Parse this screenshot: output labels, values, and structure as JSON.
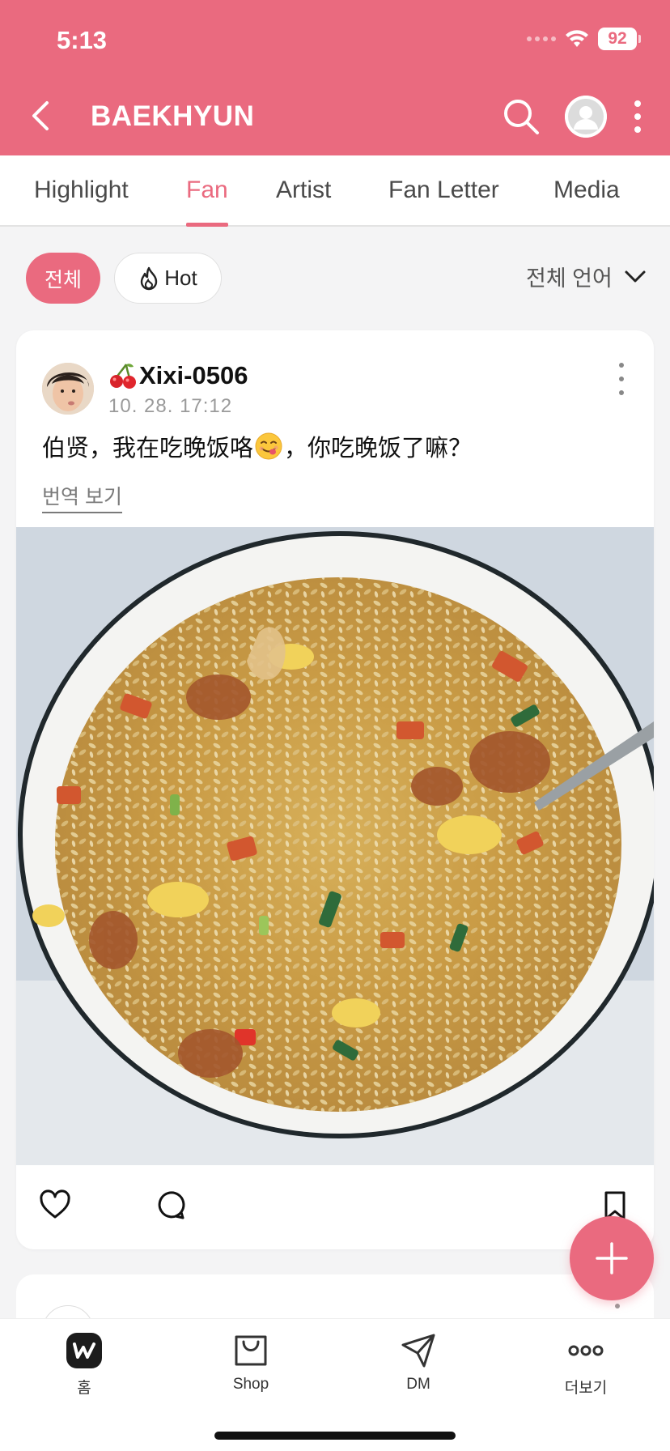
{
  "status_bar": {
    "time": "5:13",
    "battery": "92"
  },
  "header": {
    "title": "BAEKHYUN"
  },
  "tabs": [
    {
      "label": "Highlight",
      "active": false
    },
    {
      "label": "Fan",
      "active": true
    },
    {
      "label": "Artist",
      "active": false
    },
    {
      "label": "Fan Letter",
      "active": false
    },
    {
      "label": "Media",
      "active": false
    }
  ],
  "filters": {
    "all_label": "전체",
    "hot_label": "Hot",
    "language_label": "전체 언어"
  },
  "post": {
    "author": "Xixi-0506",
    "timestamp": "10. 28. 17:12",
    "text_part1": "伯贤，我在吃晚饭咯",
    "text_part2": "，你吃晚饭了嘛？",
    "translate_label": "번역 보기"
  },
  "bottom_nav": [
    {
      "label": "홈",
      "icon": "weverse-home-icon"
    },
    {
      "label": "Shop",
      "icon": "shopping-bag-icon"
    },
    {
      "label": "DM",
      "icon": "paper-plane-icon"
    },
    {
      "label": "더보기",
      "icon": "more-dots-icon"
    }
  ],
  "colors": {
    "brand": "#ea6a7f",
    "background": "#f4f4f5"
  }
}
